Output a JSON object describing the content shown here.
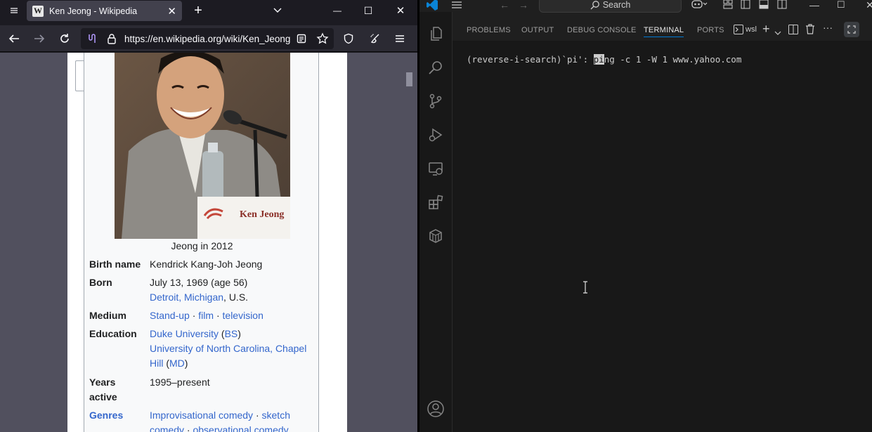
{
  "firefox": {
    "tab_title": "Ken Jeong - Wikipedia",
    "favicon_letter": "W",
    "url": "https://en.wikipedia.org/wiki/Ken_Jeong",
    "new_tab_label": "+",
    "window_min": "—",
    "window_max": "☐",
    "window_close": "✕"
  },
  "wiki": {
    "photo_caption": "Jeong in 2012",
    "nameplate": "Ken Jeong",
    "infobox": {
      "birth_name_label": "Birth name",
      "birth_name": "Kendrick Kang-Joh Jeong",
      "born_label": "Born",
      "born_date": "July 13, 1969 (age 56)",
      "born_place_city": "Detroit",
      "born_place_sep": ", ",
      "born_place_state": "Michigan",
      "born_place_country": ", U.S.",
      "medium_label": "Medium",
      "medium_1": "Stand-up",
      "medium_2": "film",
      "medium_3": "television",
      "bullet": " · ",
      "education_label": "Education",
      "edu_1": "Duke University",
      "edu_1_deg": "BS",
      "edu_2": "University of North Carolina, Chapel Hill",
      "edu_2_deg": "MD",
      "years_label_1": "Years",
      "years_label_2": "active",
      "years": "1995–present",
      "genres_label": "Genres",
      "genre_1": "Improvisational comedy",
      "genre_2": "sketch comedy",
      "genre_3": "observational comedy"
    }
  },
  "vscode": {
    "search_label": "Search",
    "panel_tabs": [
      "PROBLEMS",
      "OUTPUT",
      "DEBUG CONSOLE",
      "TERMINAL",
      "PORTS"
    ],
    "terminal_profile": "wsl",
    "terminal_prompt": "(reverse-i-search)`pi': ",
    "terminal_match": "pi",
    "terminal_rest": "ng -c 1 -W 1 www.yahoo.com"
  },
  "colors": {
    "link": "#3366cc",
    "vscode_accent": "#0078d4"
  }
}
